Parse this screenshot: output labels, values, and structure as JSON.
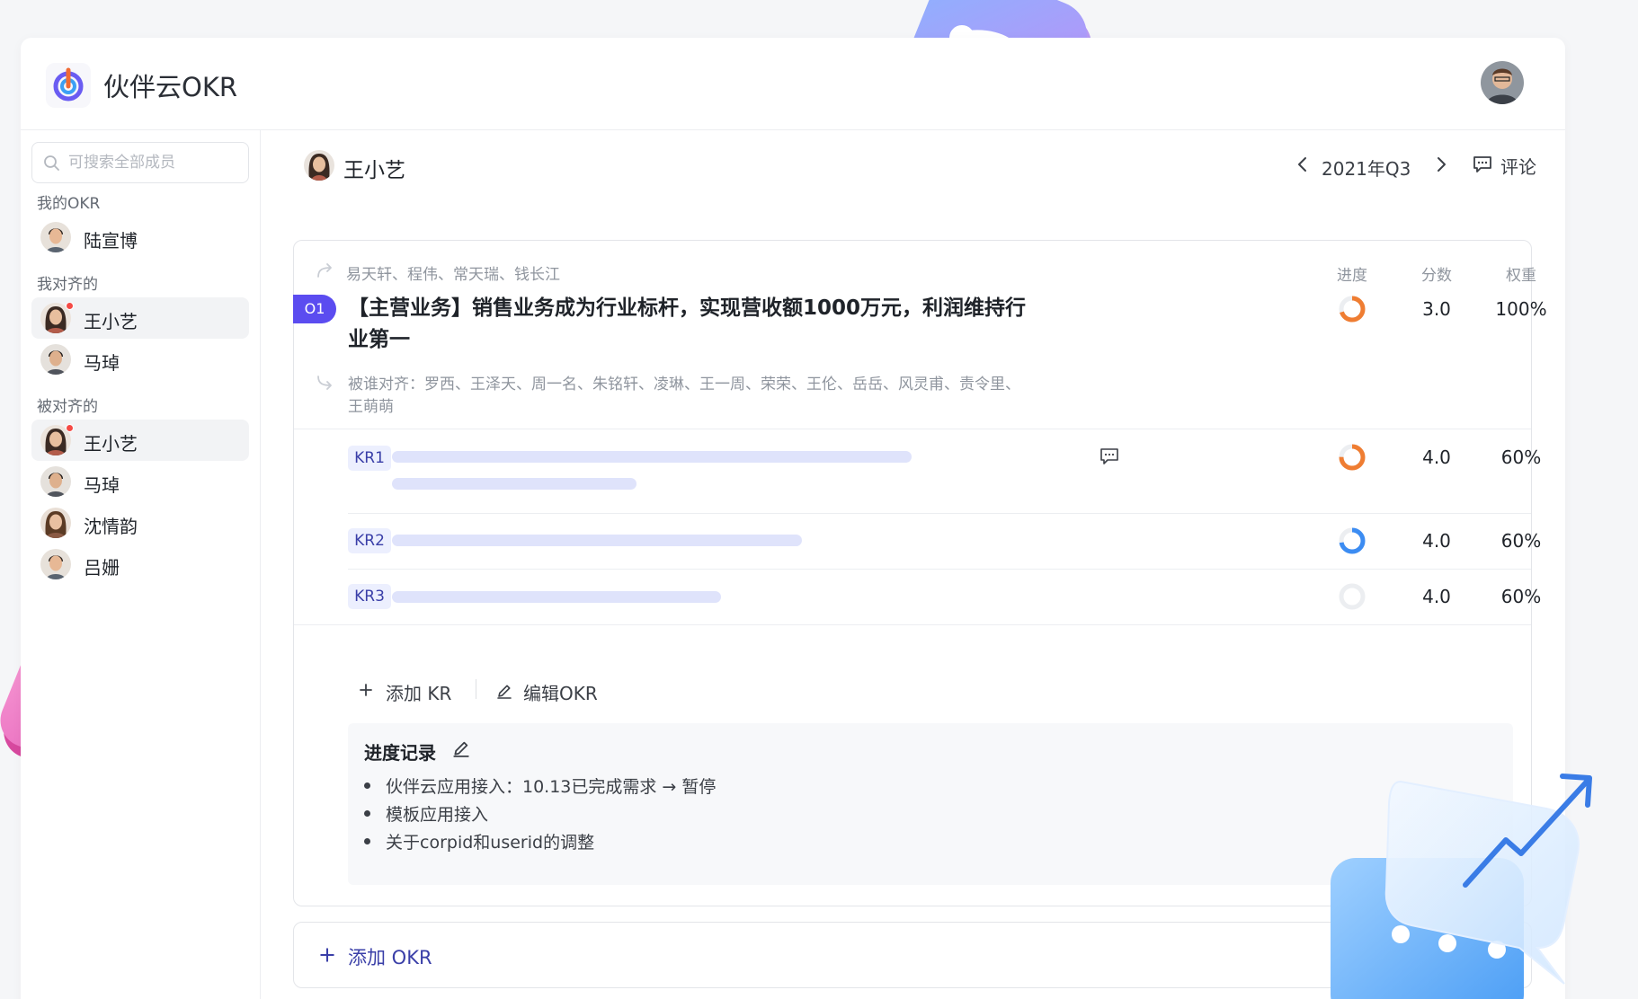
{
  "app": {
    "title": "伙伴云OKR"
  },
  "sidebar": {
    "search_placeholder": "可搜索全部成员",
    "sections": [
      {
        "label": "我的OKR",
        "members": [
          {
            "name": "陆宣博",
            "active": false,
            "notify": false
          }
        ]
      },
      {
        "label": "我对齐的",
        "members": [
          {
            "name": "王小艺",
            "active": true,
            "notify": true
          },
          {
            "name": "马琸",
            "active": false,
            "notify": false
          }
        ]
      },
      {
        "label": "被对齐的",
        "members": [
          {
            "name": "王小艺",
            "active": true,
            "notify": true
          },
          {
            "name": "马琸",
            "active": false,
            "notify": false
          },
          {
            "name": "沈情韵",
            "active": false,
            "notify": false
          },
          {
            "name": "吕姗",
            "active": false,
            "notify": false
          }
        ]
      }
    ]
  },
  "header": {
    "owner_name": "王小艺",
    "period": "2021年Q3",
    "comment_label": "评论"
  },
  "objective": {
    "aligned_to": "易天轩、程伟、常天瑞、钱长江",
    "badge": "O1",
    "title": "【主营业务】销售业务成为行业标杆，实现营收额1000万元，利润维持行业第一",
    "aligned_by": "被谁对齐：罗西、王泽天、周一名、朱铭轩、凌琳、王一周、荣荣、王伦、岳岳、风灵甫、责令里、王萌萌",
    "columns": {
      "progress": "进度",
      "score": "分数",
      "weight": "权重"
    },
    "progress": 0.7,
    "score": "3.0",
    "weight": "100%",
    "colors": {
      "accent": "#5b4cf0",
      "progress_orange": "#ef7d32",
      "progress_blue": "#3c8cf2"
    }
  },
  "key_results": [
    {
      "tag": "KR1",
      "progress": 0.75,
      "score": "4.0",
      "weight": "60%",
      "color": "#ef7d32",
      "has_comment": true
    },
    {
      "tag": "KR2",
      "progress": 0.72,
      "score": "4.0",
      "weight": "60%",
      "color": "#3c8cf2",
      "has_comment": false
    },
    {
      "tag": "KR3",
      "progress": 0,
      "score": "4.0",
      "weight": "60%",
      "color": "#3c8cf2",
      "has_comment": false
    }
  ],
  "actions": {
    "add_kr": "添加 KR",
    "edit_okr": "编辑OKR"
  },
  "progress_log": {
    "title": "进度记录",
    "items": [
      "伙伴云应用接入：10.13已完成需求 → 暂停",
      "模板应用接入",
      "关于corpid和userid的调整"
    ]
  },
  "add_okr_label": "添加 OKR"
}
